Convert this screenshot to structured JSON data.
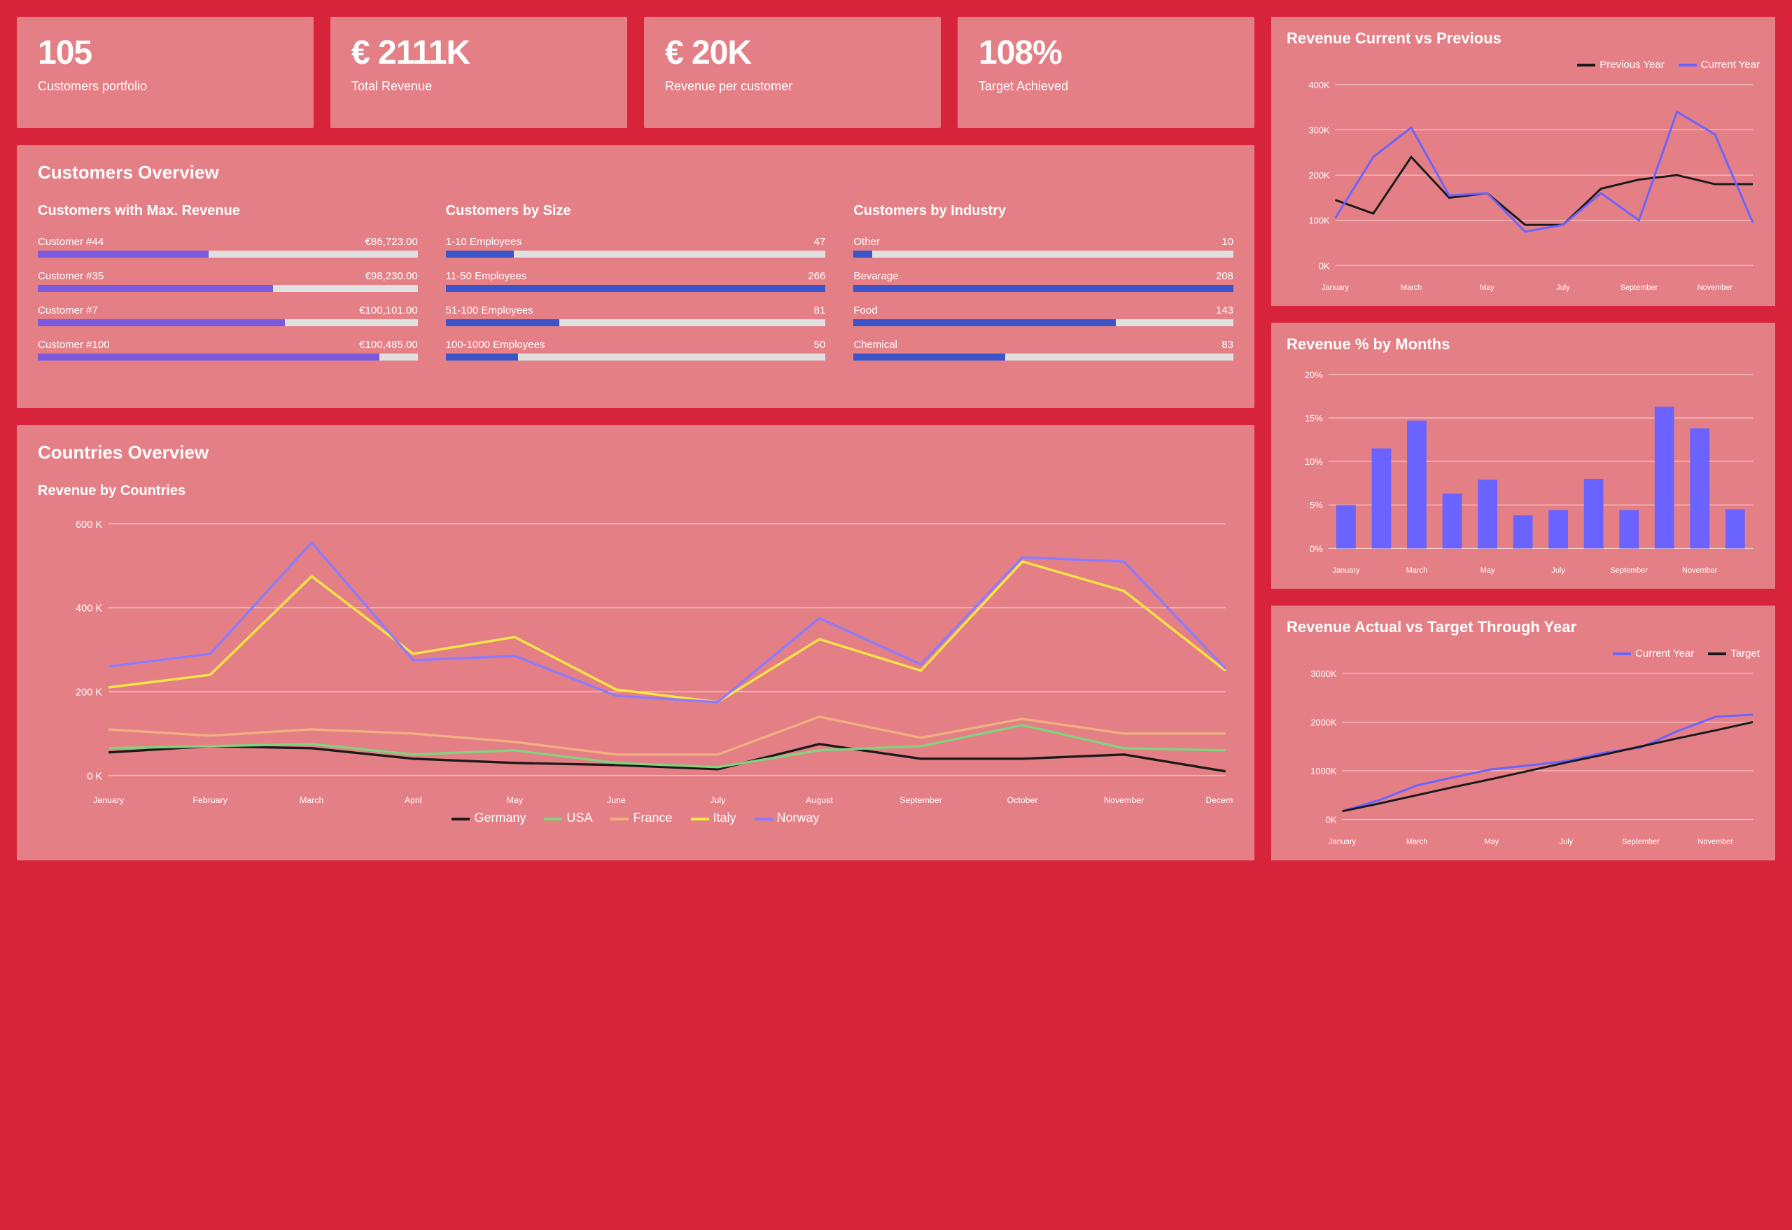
{
  "kpi": [
    {
      "value": "105",
      "label": "Customers portfolio"
    },
    {
      "value": "€ 2111K",
      "label": "Total Revenue"
    },
    {
      "value": "€ 20K",
      "label": "Revenue per customer"
    },
    {
      "value": "108%",
      "label": "Target Achieved"
    }
  ],
  "sections": {
    "customers_title": "Customers Overview",
    "countries_title": "Countries Overview",
    "countries_sub": "Revenue by Countries",
    "maxrev": "Customers with Max. Revenue",
    "bysize": "Customers by Size",
    "byind": "Customers by Industry",
    "rvp": "Revenue Current vs Previous",
    "rpm": "Revenue % by Months",
    "rat": "Revenue Actual vs Target Through Year"
  },
  "legends": {
    "rvp": [
      "Previous Year",
      "Current Year"
    ],
    "countries": [
      "Germany",
      "USA",
      "France",
      "Italy",
      "Norway"
    ],
    "rat": [
      "Current Year",
      "Target"
    ]
  },
  "chart_data": [
    {
      "id": "customers_max_revenue",
      "type": "bar",
      "orientation": "horizontal",
      "categories": [
        "Customer #44",
        "Customer #35",
        "Customer #7",
        "Customer #100"
      ],
      "values": [
        86723.0,
        98230.0,
        100101.0,
        100485.0
      ],
      "value_labels": [
        "€86,723.00",
        "€98,230.00",
        "€100,101.00",
        "€100,485.00"
      ],
      "pct": [
        45,
        62,
        65,
        90
      ],
      "color": "#7b5ae0"
    },
    {
      "id": "customers_by_size",
      "type": "bar",
      "orientation": "horizontal",
      "categories": [
        "1-10 Employees",
        "11-50 Employees",
        "51-100 Employees",
        "100-1000 Employees"
      ],
      "values": [
        47,
        266,
        81,
        50
      ],
      "pct": [
        18,
        100,
        30,
        19
      ],
      "color": "#3955c9"
    },
    {
      "id": "customers_by_industry",
      "type": "bar",
      "orientation": "horizontal",
      "categories": [
        "Other",
        "Bevarage",
        "Food",
        "Chemical"
      ],
      "values": [
        10,
        208,
        143,
        83
      ],
      "pct": [
        5,
        100,
        69,
        40
      ],
      "color": "#3955c9"
    },
    {
      "id": "revenue_current_vs_previous",
      "type": "line",
      "x_ticks": [
        "January",
        "March",
        "May",
        "July",
        "September",
        "November"
      ],
      "categories": [
        "Jan",
        "Feb",
        "Mar",
        "Apr",
        "May",
        "Jun",
        "Jul",
        "Aug",
        "Sep",
        "Oct",
        "Nov",
        "Dec"
      ],
      "series": [
        {
          "name": "Previous Year",
          "color": "#1a1a1a",
          "values": [
            145,
            115,
            240,
            150,
            160,
            90,
            90,
            170,
            190,
            200,
            180,
            180
          ]
        },
        {
          "name": "Current Year",
          "color": "#6a63ff",
          "values": [
            105,
            240,
            305,
            155,
            160,
            75,
            90,
            160,
            100,
            340,
            290,
            95
          ]
        }
      ],
      "ylim": [
        0,
        400
      ],
      "y_ticks": [
        0,
        100,
        200,
        300,
        400
      ],
      "y_tick_labels": [
        "0K",
        "100K",
        "200K",
        "300K",
        "400K"
      ]
    },
    {
      "id": "revenue_pct_by_months",
      "type": "bar",
      "x_ticks": [
        "January",
        "March",
        "May",
        "July",
        "September",
        "November"
      ],
      "categories": [
        "Jan",
        "Feb",
        "Mar",
        "Apr",
        "May",
        "Jun",
        "Jul",
        "Aug",
        "Sep",
        "Oct",
        "Nov",
        "Dec"
      ],
      "values": [
        5,
        11.5,
        14.7,
        6.3,
        7.9,
        3.8,
        4.4,
        8,
        4.4,
        16.3,
        13.8,
        4.5
      ],
      "ylim": [
        0,
        20
      ],
      "y_ticks": [
        0,
        5,
        10,
        15,
        20
      ],
      "y_tick_labels": [
        "0%",
        "5%",
        "10%",
        "15%",
        "20%"
      ],
      "color": "#6a63ff"
    },
    {
      "id": "revenue_actual_vs_target",
      "type": "line",
      "x_ticks": [
        "January",
        "March",
        "May",
        "July",
        "September",
        "November"
      ],
      "categories": [
        "Jan",
        "Feb",
        "Mar",
        "Apr",
        "May",
        "Jun",
        "Jul",
        "Aug",
        "Sep",
        "Oct",
        "Nov",
        "Dec"
      ],
      "series": [
        {
          "name": "Current Year",
          "color": "#6a63ff",
          "values": [
            170,
            400,
            700,
            870,
            1030,
            1110,
            1200,
            1370,
            1480,
            1820,
            2110,
            2150
          ]
        },
        {
          "name": "Target",
          "color": "#1a1a1a",
          "values": [
            170,
            330,
            500,
            670,
            830,
            1000,
            1170,
            1330,
            1500,
            1670,
            1830,
            2000
          ]
        }
      ],
      "ylim": [
        0,
        3000
      ],
      "y_ticks": [
        0,
        1000,
        2000,
        3000
      ],
      "y_tick_labels": [
        "0K",
        "1000K",
        "2000K",
        "3000K"
      ]
    },
    {
      "id": "revenue_by_countries",
      "type": "line",
      "categories": [
        "January",
        "February",
        "March",
        "April",
        "May",
        "June",
        "July",
        "August",
        "September",
        "October",
        "November",
        "December"
      ],
      "series": [
        {
          "name": "Germany",
          "color": "#1a1a1a",
          "values": [
            55,
            70,
            65,
            40,
            30,
            25,
            15,
            75,
            40,
            40,
            50,
            10
          ]
        },
        {
          "name": "USA",
          "color": "#7fd47f",
          "values": [
            65,
            70,
            75,
            50,
            60,
            30,
            20,
            60,
            70,
            120,
            65,
            60
          ]
        },
        {
          "name": "France",
          "color": "#f0b080",
          "values": [
            110,
            95,
            110,
            100,
            80,
            50,
            50,
            140,
            90,
            135,
            100,
            100
          ]
        },
        {
          "name": "Italy",
          "color": "#f7e742",
          "values": [
            210,
            240,
            475,
            290,
            330,
            205,
            175,
            325,
            250,
            510,
            440,
            250
          ]
        },
        {
          "name": "Norway",
          "color": "#8b7bff",
          "values": [
            260,
            290,
            555,
            275,
            285,
            190,
            175,
            375,
            265,
            520,
            510,
            255
          ]
        }
      ],
      "ylim": [
        0,
        600
      ],
      "y_ticks": [
        0,
        200,
        400,
        600
      ],
      "y_tick_labels": [
        "0 K",
        "200 K",
        "400 K",
        "600 K"
      ]
    }
  ]
}
